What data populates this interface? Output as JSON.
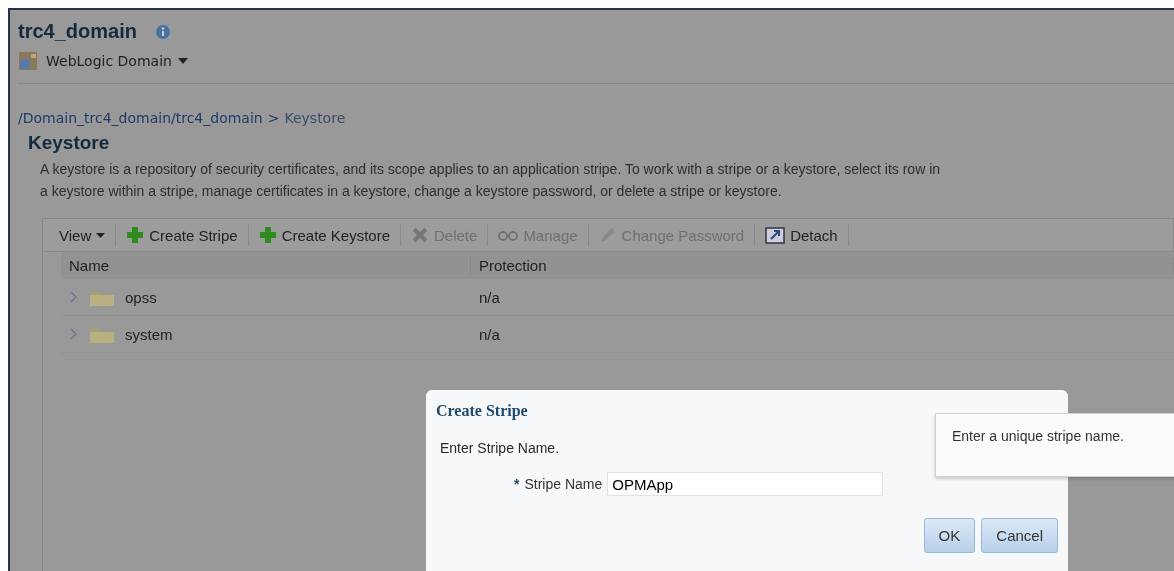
{
  "header": {
    "title": "trc4_domain",
    "menu": "WebLogic Domain"
  },
  "breadcrumb": {
    "path": "/Domain_trc4_domain/trc4_domain",
    "separator": ">",
    "current": "Keystore"
  },
  "page": {
    "heading": "Keystore",
    "description": "A keystore is a repository of security certificates, and its scope applies to an application stripe. To work with a stripe or a keystore, select its row in\na keystore within a stripe, manage certificates in a keystore, change a keystore password, or delete a stripe or keystore."
  },
  "toolbar": [
    {
      "kind": "menu",
      "label": "View",
      "disabled": false
    },
    {
      "kind": "add",
      "label": "Create Stripe",
      "disabled": false
    },
    {
      "kind": "add",
      "label": "Create Keystore",
      "disabled": false
    },
    {
      "kind": "delete",
      "label": "Delete",
      "disabled": true
    },
    {
      "kind": "manage",
      "label": "Manage",
      "disabled": true
    },
    {
      "kind": "password",
      "label": "Change Password",
      "disabled": true
    },
    {
      "kind": "detach",
      "label": "Detach",
      "disabled": false
    }
  ],
  "table": {
    "columns": [
      "Name",
      "Protection"
    ],
    "rows": [
      {
        "name": "opss",
        "protection": "n/a",
        "expanded": false
      },
      {
        "name": "system",
        "protection": "n/a",
        "expanded": false
      }
    ]
  },
  "dialog": {
    "title": "Create Stripe",
    "instruction": "Enter Stripe Name.",
    "required_mark": "*",
    "field_label": "Stripe Name",
    "field_value": "OPMApp",
    "buttons": [
      "OK",
      "Cancel"
    ]
  },
  "tooltip": "Enter a unique stripe name."
}
